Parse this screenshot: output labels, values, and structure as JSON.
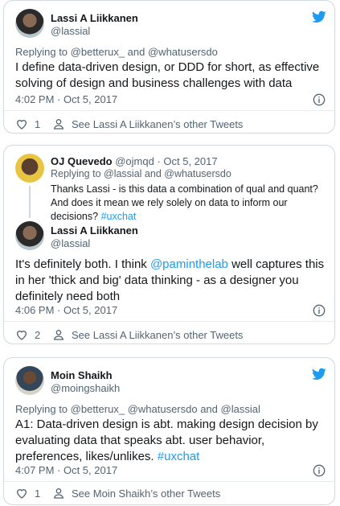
{
  "tweets": [
    {
      "author_name": "Lassi A Liikkanen",
      "author_handle": "@lassial",
      "reply_prefix": "Replying to ",
      "reply_to_1": "@betterux_",
      "reply_and": " and ",
      "reply_to_2": "@whatusersdo",
      "text": "I define data-driven design, or DDD for short, as effective solving of design and business challenges with data",
      "time": "4:02 PM · Oct 5, 2017",
      "like_count": "1",
      "other_tweets": "See Lassi A Liikkanen’s other Tweets"
    },
    {
      "parent": {
        "author_name": "OJ Quevedo",
        "author_handle": "@ojmqd",
        "date": "· Oct 5, 2017",
        "reply_prefix": "Replying to ",
        "reply_to_1": "@lassial",
        "reply_and": " and ",
        "reply_to_2": "@whatusersdo",
        "text": "Thanks Lassi - is this data a combination of qual and quant? And does it mean we rely solely on data to inform our decisions?",
        "hashtag": "#uxchat"
      },
      "author_name": "Lassi A Liikkanen",
      "author_handle": "@lassial",
      "text_1": "It's definitely both. I think ",
      "mention": "@paminthelab",
      "text_2": " well captures this in her 'thick and big' data thinking - as a designer you definitely need both",
      "time": "4:06 PM · Oct 5, 2017",
      "like_count": "2",
      "other_tweets": "See Lassi A Liikkanen’s other Tweets"
    },
    {
      "author_name": "Moin Shaikh",
      "author_handle": "@moingshaikh",
      "reply_prefix": "Replying to ",
      "reply_to_1": "@betterux_",
      "reply_to_2": "@whatusersdo",
      "reply_and": " and ",
      "reply_to_3": "@lassial",
      "text": "A1: Data-driven design is abt. making design decision by evaluating data that speaks abt. user behavior, preferences, likes/unlikes.",
      "hashtag": "#uxchat",
      "time": "4:07 PM · Oct 5, 2017",
      "like_count": "1",
      "other_tweets": "See Moin Shaikh’s other Tweets"
    }
  ],
  "colors": {
    "twitter_blue": "#1d9bf0",
    "muted": "#536471",
    "border": "#cfd9de"
  },
  "icons": [
    "twitter-bird-icon",
    "info-icon",
    "heart-icon",
    "user-icon"
  ]
}
